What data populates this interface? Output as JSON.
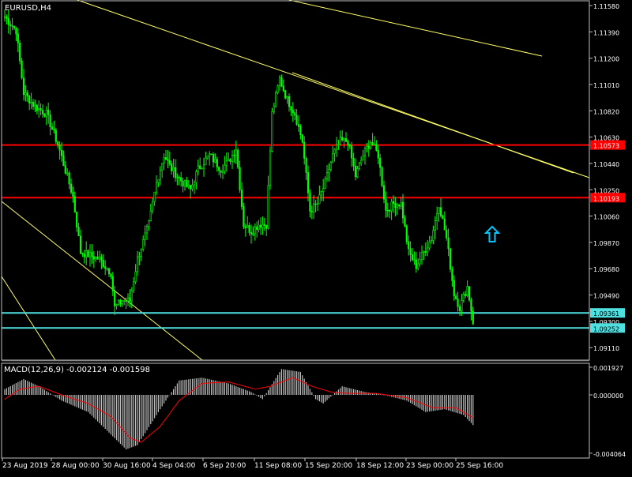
{
  "symbol_label": "EURUSD,H4",
  "indicator_label": "MACD(12,26,9) -0.002124 -0.001598",
  "colors": {
    "background": "#000000",
    "grid": "#3a3a3a",
    "frame": "#c0c0c0",
    "bull_body": "#000000",
    "candle": "#00ff00",
    "trendline": "#ffff66",
    "resistance": "#ff0000",
    "support": "#4fdfe0",
    "arrow": "#00c8ff",
    "macd_hist": "#c0c0c0",
    "macd_signal": "#ff0000",
    "text": "#ffffff"
  },
  "price_axis": {
    "ticks": [
      "1.11580",
      "1.11390",
      "1.11200",
      "1.11010",
      "1.10820",
      "1.10630",
      "1.10440",
      "1.10250",
      "1.10060",
      "1.09870",
      "1.09680",
      "1.09490",
      "1.09300",
      "1.09110"
    ],
    "min": 1.0902,
    "max": 1.1162
  },
  "price_tags": [
    {
      "label": "1.10573",
      "value": 1.10573,
      "kind": "resistance"
    },
    {
      "label": "1.10193",
      "value": 1.10193,
      "kind": "resistance"
    },
    {
      "label": "1.09361",
      "value": 1.09361,
      "kind": "support"
    },
    {
      "label": "1.09252",
      "value": 1.09252,
      "kind": "support"
    }
  ],
  "macd_axis": {
    "ticks": [
      "0.001927",
      "0.000000",
      "-0.004064"
    ],
    "min": -0.0044,
    "max": 0.0022
  },
  "time_axis": {
    "labels": [
      "23 Aug 2019",
      "28 Aug 00:00",
      "30 Aug 16:00",
      "4 Sep 04:00",
      "6 Sep 20:00",
      "11 Sep 08:00",
      "15 Sep 20:00",
      "18 Sep 12:00",
      "23 Sep 00:00",
      "25 Sep 16:00"
    ]
  },
  "chart_data": {
    "type": "candlestick",
    "symbol": "EURUSD",
    "timeframe": "H4",
    "close_anchors": [
      [
        0,
        1.115
      ],
      [
        6,
        1.114
      ],
      [
        10,
        1.1095
      ],
      [
        16,
        1.1085
      ],
      [
        22,
        1.108
      ],
      [
        28,
        1.1058
      ],
      [
        36,
        1.102
      ],
      [
        40,
        1.098
      ],
      [
        50,
        1.0975
      ],
      [
        56,
        1.0965
      ],
      [
        58,
        1.094
      ],
      [
        62,
        1.0945
      ],
      [
        66,
        1.0945
      ],
      [
        70,
        1.0975
      ],
      [
        76,
        1.1
      ],
      [
        80,
        1.103
      ],
      [
        84,
        1.105
      ],
      [
        88,
        1.104
      ],
      [
        94,
        1.103
      ],
      [
        98,
        1.1025
      ],
      [
        102,
        1.104
      ],
      [
        108,
        1.105
      ],
      [
        114,
        1.104
      ],
      [
        118,
        1.1045
      ],
      [
        122,
        1.1055
      ],
      [
        126,
        1.1
      ],
      [
        130,
        1.0995
      ],
      [
        134,
        1.1
      ],
      [
        138,
        1.1
      ],
      [
        141,
        1.108
      ],
      [
        145,
        1.1105
      ],
      [
        149,
        1.109
      ],
      [
        153,
        1.108
      ],
      [
        157,
        1.106
      ],
      [
        161,
        1.101
      ],
      [
        165,
        1.1015
      ],
      [
        169,
        1.103
      ],
      [
        173,
        1.105
      ],
      [
        177,
        1.106
      ],
      [
        181,
        1.106
      ],
      [
        185,
        1.1035
      ],
      [
        189,
        1.105
      ],
      [
        193,
        1.106
      ],
      [
        197,
        1.105
      ],
      [
        201,
        1.101
      ],
      [
        205,
        1.1015
      ],
      [
        209,
        1.1015
      ],
      [
        213,
        1.098
      ],
      [
        217,
        1.097
      ],
      [
        221,
        1.098
      ],
      [
        225,
        1.099
      ],
      [
        229,
        1.1015
      ],
      [
        233,
        1.099
      ],
      [
        237,
        1.095
      ],
      [
        240,
        1.094
      ],
      [
        244,
        1.0955
      ],
      [
        247,
        1.093
      ]
    ],
    "macd_hist_anchors": [
      [
        0,
        0.0004
      ],
      [
        10,
        0.0011
      ],
      [
        18,
        0.0006
      ],
      [
        30,
        -0.0004
      ],
      [
        44,
        -0.0012
      ],
      [
        54,
        -0.0025
      ],
      [
        64,
        -0.0038
      ],
      [
        70,
        -0.0035
      ],
      [
        82,
        -0.001
      ],
      [
        92,
        0.001
      ],
      [
        104,
        0.0012
      ],
      [
        118,
        0.0008
      ],
      [
        130,
        0.0002
      ],
      [
        136,
        -0.0003
      ],
      [
        146,
        0.0018
      ],
      [
        156,
        0.0016
      ],
      [
        164,
        -0.0003
      ],
      [
        168,
        -0.0006
      ],
      [
        178,
        0.0006
      ],
      [
        190,
        0.0002
      ],
      [
        200,
        0.0
      ],
      [
        212,
        -0.0004
      ],
      [
        222,
        -0.0012
      ],
      [
        232,
        -0.001
      ],
      [
        242,
        -0.0014
      ],
      [
        247,
        -0.0021
      ]
    ],
    "macd_signal_anchors": [
      [
        0,
        -0.0003
      ],
      [
        8,
        0.0004
      ],
      [
        18,
        0.0006
      ],
      [
        30,
        0.0
      ],
      [
        44,
        -0.0006
      ],
      [
        56,
        -0.0015
      ],
      [
        66,
        -0.003
      ],
      [
        72,
        -0.0033
      ],
      [
        82,
        -0.0022
      ],
      [
        92,
        -0.0004
      ],
      [
        104,
        0.0008
      ],
      [
        118,
        0.0009
      ],
      [
        132,
        0.0004
      ],
      [
        140,
        0.0006
      ],
      [
        152,
        0.0012
      ],
      [
        162,
        0.0006
      ],
      [
        172,
        0.0002
      ],
      [
        182,
        0.0001
      ],
      [
        196,
        0.0001
      ],
      [
        212,
        -0.0002
      ],
      [
        226,
        -0.0009
      ],
      [
        238,
        -0.0009
      ],
      [
        247,
        -0.0016
      ]
    ]
  }
}
